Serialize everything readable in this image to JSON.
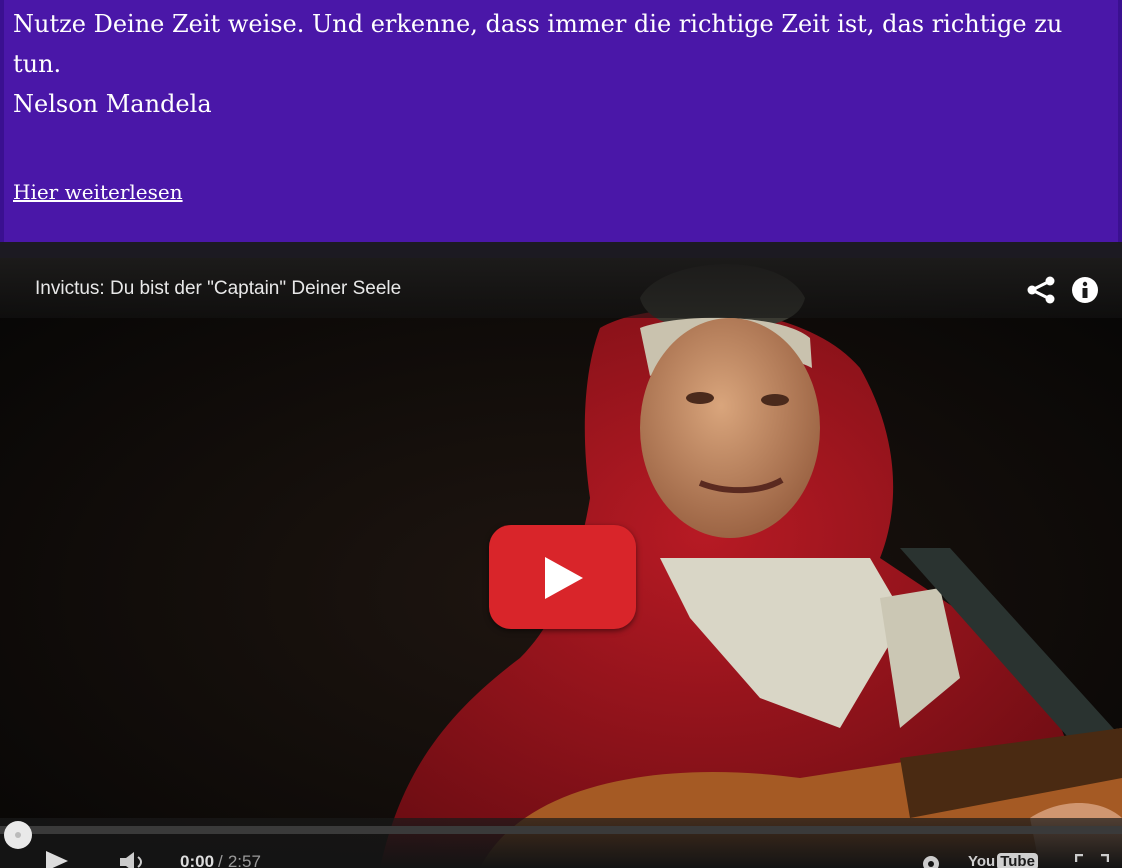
{
  "quote": {
    "text": "Nutze Deine Zeit weise. Und erkenne, dass immer die richtige Zeit ist, das richtige zu tun.",
    "author": "Nelson Mandela",
    "read_more": "Hier weiterlesen"
  },
  "video": {
    "title": "Invictus: Du bist der \"Captain\" Deiner Seele",
    "current_time": "0:00",
    "separator": "/",
    "duration": "2:57",
    "progress": 0,
    "logo_you": "You",
    "logo_tube": "Tube",
    "icons": [
      "share-icon",
      "info-icon",
      "play-icon",
      "volume-icon",
      "settings-icon",
      "youtube-logo",
      "fullscreen-icon"
    ],
    "colors": {
      "play_button": "#d9252a",
      "quote_background": "#4a17a8"
    }
  }
}
